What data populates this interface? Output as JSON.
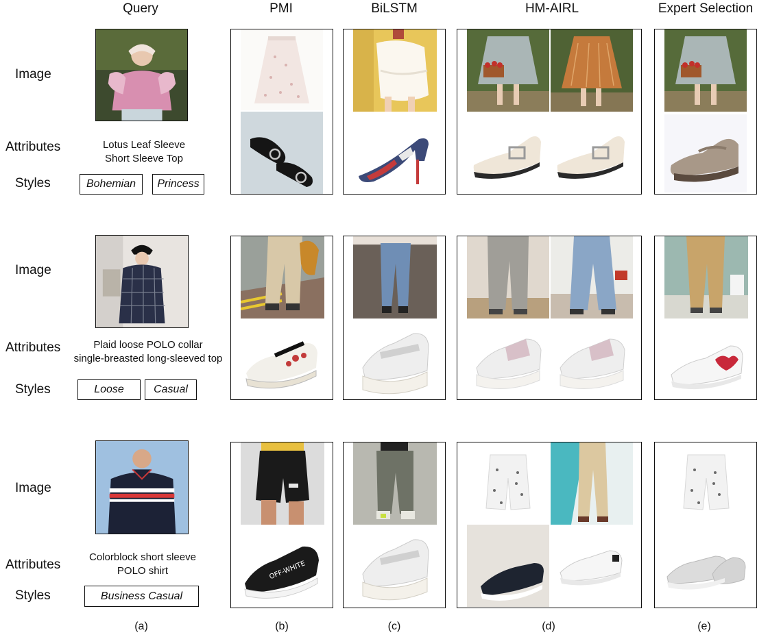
{
  "columns": {
    "query": "Query",
    "pmi": "PMI",
    "bilstm": "BiLSTM",
    "hmairl": "HM-AIRL",
    "expert": "Expert Selection"
  },
  "row_labels": {
    "image": "Image",
    "attributes": "Attributes",
    "styles": "Styles"
  },
  "rows": [
    {
      "attributes_line1": "Lotus Leaf Sleeve",
      "attributes_line2": "Short Sleeve Top",
      "styles": [
        "Bohemian",
        "Princess"
      ]
    },
    {
      "attributes_line1": "Plaid loose POLO collar",
      "attributes_line2": "single-breasted long-sleeved top",
      "styles": [
        "Loose",
        "Casual"
      ]
    },
    {
      "attributes_line1": "Colorblock short sleeve",
      "attributes_line2": "POLO shirt",
      "styles": [
        "Business Casual"
      ]
    }
  ],
  "sublabels": [
    "(a)",
    "(b)",
    "(c)",
    "(d)",
    "(e)"
  ],
  "shoe_print_text": "OFF-WHITE"
}
